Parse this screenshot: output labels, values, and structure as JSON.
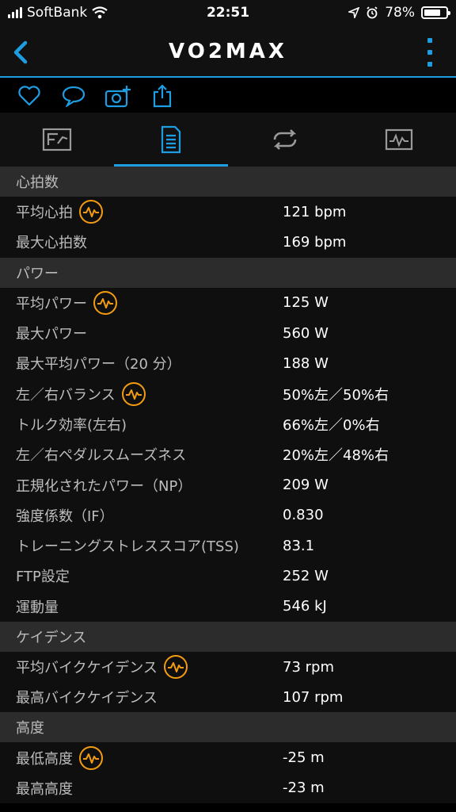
{
  "status": {
    "carrier": "SoftBank",
    "time": "22:51",
    "battery": "78%",
    "battery_level": 0.78
  },
  "header": {
    "title": "VO2MAX"
  },
  "sections": [
    {
      "title": "心拍数",
      "rows": [
        {
          "label": "平均心拍",
          "value": "121 bpm",
          "badge": true
        },
        {
          "label": "最大心拍数",
          "value": "169 bpm",
          "badge": false
        }
      ]
    },
    {
      "title": "パワー",
      "rows": [
        {
          "label": "平均パワー",
          "value": "125 W",
          "badge": true
        },
        {
          "label": "最大パワー",
          "value": "560 W",
          "badge": false
        },
        {
          "label": "最大平均パワー（20 分）",
          "value": "188 W",
          "badge": false
        },
        {
          "label": "左／右バランス",
          "value": "50%左／50%右",
          "badge": true
        },
        {
          "label": "トルク効率(左右)",
          "value": "66%左／0%右",
          "badge": false
        },
        {
          "label": "左／右ペダルスムーズネス",
          "value": "20%左／48%右",
          "badge": false
        },
        {
          "label": "正規化されたパワー（NP）",
          "value": "209 W",
          "badge": false
        },
        {
          "label": "強度係数（IF）",
          "value": "0.830",
          "badge": false
        },
        {
          "label": "トレーニングストレススコア(TSS)",
          "value": "83.1",
          "badge": false
        },
        {
          "label": "FTP設定",
          "value": "252 W",
          "badge": false
        },
        {
          "label": "運動量",
          "value": "546 kJ",
          "badge": false
        }
      ]
    },
    {
      "title": "ケイデンス",
      "rows": [
        {
          "label": "平均バイクケイデンス",
          "value": "73 rpm",
          "badge": true
        },
        {
          "label": "最高バイクケイデンス",
          "value": "107 rpm",
          "badge": false
        }
      ]
    },
    {
      "title": "高度",
      "rows": [
        {
          "label": "最低高度",
          "value": "-25 m",
          "badge": true
        },
        {
          "label": "最高高度",
          "value": "-23 m",
          "badge": false
        }
      ]
    }
  ],
  "icons": {
    "actions": [
      "heart-icon",
      "comment-icon",
      "add-photo-icon",
      "share-icon"
    ],
    "tabs": [
      "chart-summary-icon",
      "stats-list-icon",
      "laps-icon",
      "graph-icon"
    ],
    "badge": "pulse-icon"
  },
  "colors": {
    "accent": "#1e9de3",
    "badge": "#f39c12"
  }
}
